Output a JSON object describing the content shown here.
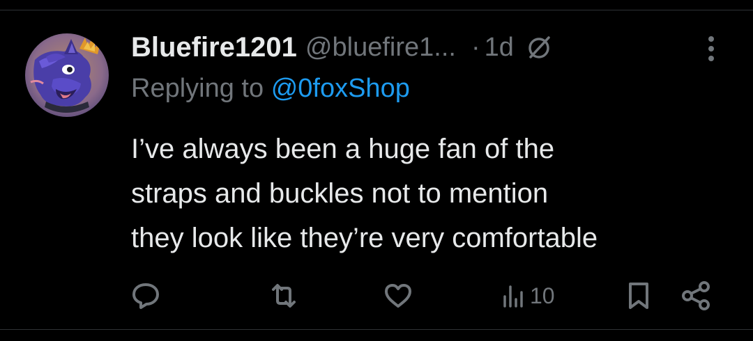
{
  "tweet": {
    "display_name": "Bluefire1201",
    "handle": "@bluefire1...",
    "separator": "·",
    "timestamp": "1d",
    "replying_prefix": "Replying to",
    "replying_to": "@0foxShop",
    "body_lines": [
      "I’ve always been a huge fan of the",
      "straps and buckles not to mention",
      "they look like they’re very comfortable"
    ]
  },
  "actions": {
    "reply_count": "",
    "retweet_count": "",
    "like_count": "",
    "views_count": "10"
  },
  "icons": {
    "avatar": "avatar-fox-character",
    "edited": "edited-slash-circle-icon",
    "more": "more-vertical-icon",
    "reply": "reply-bubble-icon",
    "retweet": "retweet-icon",
    "like": "heart-icon",
    "views": "views-bars-icon",
    "bookmark": "bookmark-icon",
    "share": "share-icon"
  },
  "colors": {
    "background": "#000000",
    "text_primary": "#e7e9ea",
    "text_secondary": "#71767b",
    "accent": "#1d9bf0",
    "divider": "#2f3336"
  }
}
